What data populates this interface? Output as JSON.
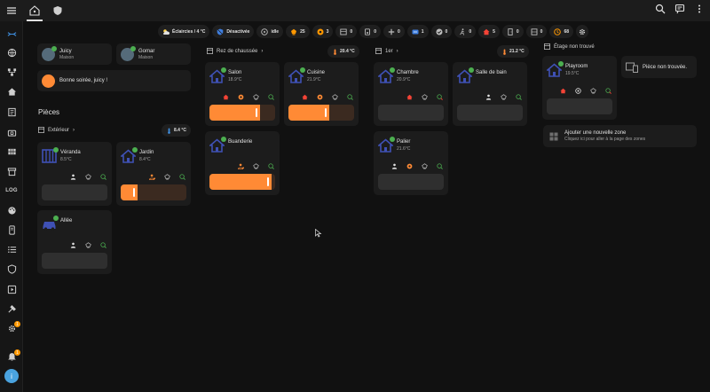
{
  "chips": [
    {
      "icon": "weather-partly-cloudy-icon",
      "label": "Éclaircies / 4 °C",
      "color": "#e1e1e1"
    },
    {
      "icon": "shield-off-icon",
      "label": "Désactivée",
      "color": "#3f7fe0"
    },
    {
      "icon": "vacuum-icon",
      "label": "idle",
      "color": "#bdbdbd"
    },
    {
      "icon": "light-icon",
      "label": "25",
      "color": "#ff9800"
    },
    {
      "icon": "fan-icon",
      "label": "3",
      "color": "#ff9800"
    },
    {
      "icon": "cover-icon",
      "label": "0",
      "color": "#bdbdbd"
    },
    {
      "icon": "speaker-icon",
      "label": "0",
      "color": "#bdbdbd"
    },
    {
      "icon": "fan-outline-icon",
      "label": "0",
      "color": "#bdbdbd"
    },
    {
      "icon": "climate-icon",
      "label": "1",
      "color": "#3f7fe0"
    },
    {
      "icon": "check-circle-icon",
      "label": "0",
      "color": "#bdbdbd"
    },
    {
      "icon": "motion-icon",
      "label": "0",
      "color": "#bdbdbd"
    },
    {
      "icon": "home-alert-icon",
      "label": "5",
      "color": "#f44336"
    },
    {
      "icon": "door-icon",
      "label": "0",
      "color": "#bdbdbd"
    },
    {
      "icon": "window-icon",
      "label": "0",
      "color": "#bdbdbd"
    },
    {
      "icon": "update-icon",
      "label": "68",
      "color": "#ff9800"
    },
    {
      "icon": "gear-icon",
      "label": "",
      "color": "#e1e1e1"
    }
  ],
  "persons": [
    {
      "name": "Juicy",
      "state": "Maison"
    },
    {
      "name": "Gomar",
      "state": "Maison"
    }
  ],
  "greeting": "Bonne soirée, juicy !",
  "rooms_title": "Pièces",
  "areas": [
    {
      "name": "Extérieur",
      "temp": "8.4 °C"
    },
    {
      "name": "Rez de chaussée",
      "temp": "20.4 °C"
    },
    {
      "name": "1er",
      "temp": "21.2 °C"
    },
    {
      "name": "Étage non trouvé",
      "temp": ""
    }
  ],
  "rooms": {
    "veranda": {
      "name": "Véranda",
      "temp": "8.5°C"
    },
    "jardin": {
      "name": "Jardin",
      "temp": "8.4°C",
      "level": 0.25
    },
    "allee": {
      "name": "Allée",
      "temp": ""
    },
    "salon": {
      "name": "Salon",
      "temp": "18.9°C",
      "level": 0.77
    },
    "cuisine": {
      "name": "Cuisine",
      "temp": "21.9°C",
      "level": 0.62
    },
    "buanderie": {
      "name": "Buanderie",
      "temp": "",
      "level": 0.95
    },
    "chambre": {
      "name": "Chambre",
      "temp": "20.9°C"
    },
    "sdb": {
      "name": "Salle de bain",
      "temp": ""
    },
    "palier": {
      "name": "Palier",
      "temp": "21.6°C"
    },
    "playroom": {
      "name": "Playroom",
      "temp": "19.5°C"
    }
  },
  "not_found": "Pièce non trouvée.",
  "add_zone": {
    "title": "Ajouter une nouvelle zone",
    "subtitle": "Cliquez ici pour aller à la page des zones"
  },
  "sidebar": {
    "log_label": "LOG",
    "settings_badge": "1",
    "notif_badge": "1",
    "avatar_letter": "i"
  },
  "colors": {
    "accent": "#ff8a35",
    "bg": "#111111",
    "card": "#1c1c1c",
    "green": "#4caf50",
    "blue": "#3f51b5"
  }
}
